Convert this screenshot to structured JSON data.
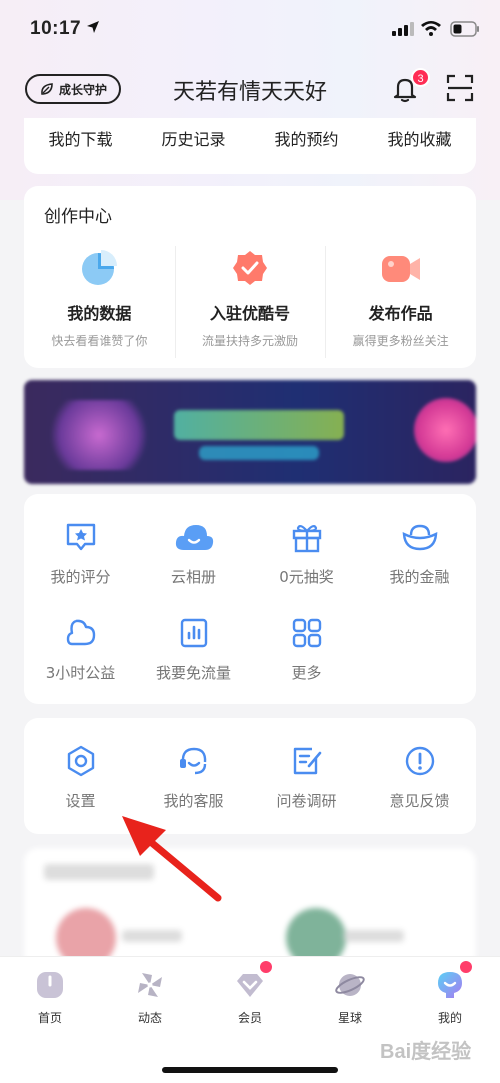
{
  "status_bar": {
    "time": "10:17"
  },
  "header": {
    "growth_label": "成长守护",
    "title": "天若有情天天好",
    "notification_count": "3"
  },
  "quick_links": [
    "我的下载",
    "历史记录",
    "我的预约",
    "我的收藏"
  ],
  "creation_center": {
    "title": "创作中心",
    "items": [
      {
        "label": "我的数据",
        "sub": "快去看看谁赞了你",
        "icon": "pie-chart-icon",
        "color": "#5ab4f0"
      },
      {
        "label": "入驻优酷号",
        "sub": "流量扶持多元激励",
        "icon": "verified-badge-icon",
        "color": "#ff7a6b"
      },
      {
        "label": "发布作品",
        "sub": "赢得更多粉丝关注",
        "icon": "video-camera-icon",
        "color": "#ff8a7a"
      }
    ]
  },
  "services": {
    "row1": [
      {
        "label": "我的评分",
        "icon": "rating-icon"
      },
      {
        "label": "云相册",
        "icon": "cloud-icon"
      },
      {
        "label": "0元抽奖",
        "icon": "gift-icon"
      },
      {
        "label": "我的金融",
        "icon": "ingot-icon"
      }
    ],
    "row2": [
      {
        "label": "3小时公益",
        "icon": "charity-icon"
      },
      {
        "label": "我要免流量",
        "icon": "data-plan-icon"
      },
      {
        "label": "更多",
        "icon": "grid-more-icon"
      }
    ]
  },
  "tools": [
    {
      "label": "设置",
      "icon": "settings-icon"
    },
    {
      "label": "我的客服",
      "icon": "customer-service-icon"
    },
    {
      "label": "问卷调研",
      "icon": "survey-icon"
    },
    {
      "label": "意见反馈",
      "icon": "feedback-icon"
    }
  ],
  "tabbar": [
    {
      "label": "首页",
      "icon": "home-icon"
    },
    {
      "label": "动态",
      "icon": "pinwheel-icon"
    },
    {
      "label": "会员",
      "icon": "vip-icon"
    },
    {
      "label": "星球",
      "icon": "planet-icon"
    },
    {
      "label": "我的",
      "icon": "profile-icon"
    }
  ],
  "colors": {
    "icon_blue": "#4a8cf0",
    "badge_red": "#ff2d55",
    "arrow_red": "#e8231c"
  }
}
